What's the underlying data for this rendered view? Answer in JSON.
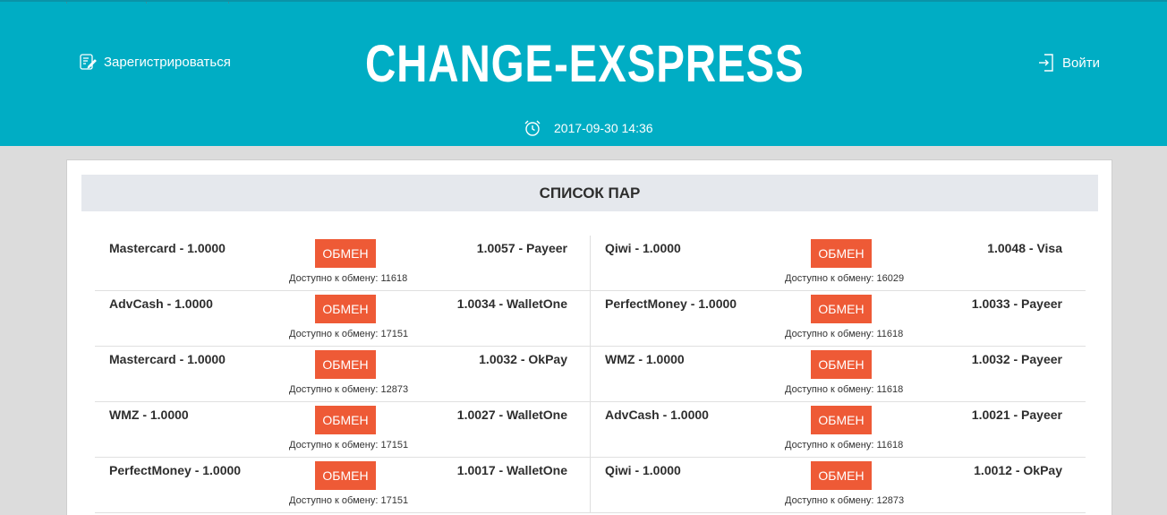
{
  "header": {
    "register_label": "Зарегистрироваться",
    "login_label": "Войти",
    "site_title": "CHANGE-EXSPRESS",
    "datetime": "2017-09-30 14:36",
    "bg_color": "#00adc4"
  },
  "main": {
    "title": "СПИСОК ПАР",
    "button_color": "#ee5a36",
    "pairs": [
      {
        "from": "Mastercard - 1.0000",
        "to": "1.0057 - Payeer",
        "button": "ОБМЕН",
        "available": "Доступно к обмену: 11618"
      },
      {
        "from": "Qiwi - 1.0000",
        "to": "1.0048 - Visa",
        "button": "ОБМЕН",
        "available": "Доступно к обмену: 16029"
      },
      {
        "from": "AdvCash - 1.0000",
        "to": "1.0034 - WalletOne",
        "button": "ОБМЕН",
        "available": "Доступно к обмену: 17151"
      },
      {
        "from": "PerfectMoney - 1.0000",
        "to": "1.0033 - Payeer",
        "button": "ОБМЕН",
        "available": "Доступно к обмену: 11618"
      },
      {
        "from": "Mastercard - 1.0000",
        "to": "1.0032 - OkPay",
        "button": "ОБМЕН",
        "available": "Доступно к обмену: 12873"
      },
      {
        "from": "WMZ - 1.0000",
        "to": "1.0032 - Payeer",
        "button": "ОБМЕН",
        "available": "Доступно к обмену: 11618"
      },
      {
        "from": "WMZ - 1.0000",
        "to": "1.0027 - WalletOne",
        "button": "ОБМЕН",
        "available": "Доступно к обмену: 17151"
      },
      {
        "from": "AdvCash - 1.0000",
        "to": "1.0021 - Payeer",
        "button": "ОБМЕН",
        "available": "Доступно к обмену: 11618"
      },
      {
        "from": "PerfectMoney - 1.0000",
        "to": "1.0017 - WalletOne",
        "button": "ОБМЕН",
        "available": "Доступно к обмену: 17151"
      },
      {
        "from": "Qiwi - 1.0000",
        "to": "1.0012 - OkPay",
        "button": "ОБМЕН",
        "available": "Доступно к обмену: 12873"
      }
    ]
  },
  "icons": {
    "register": "register-form-icon",
    "login": "login-enter-icon",
    "clock": "alarm-clock-icon"
  }
}
